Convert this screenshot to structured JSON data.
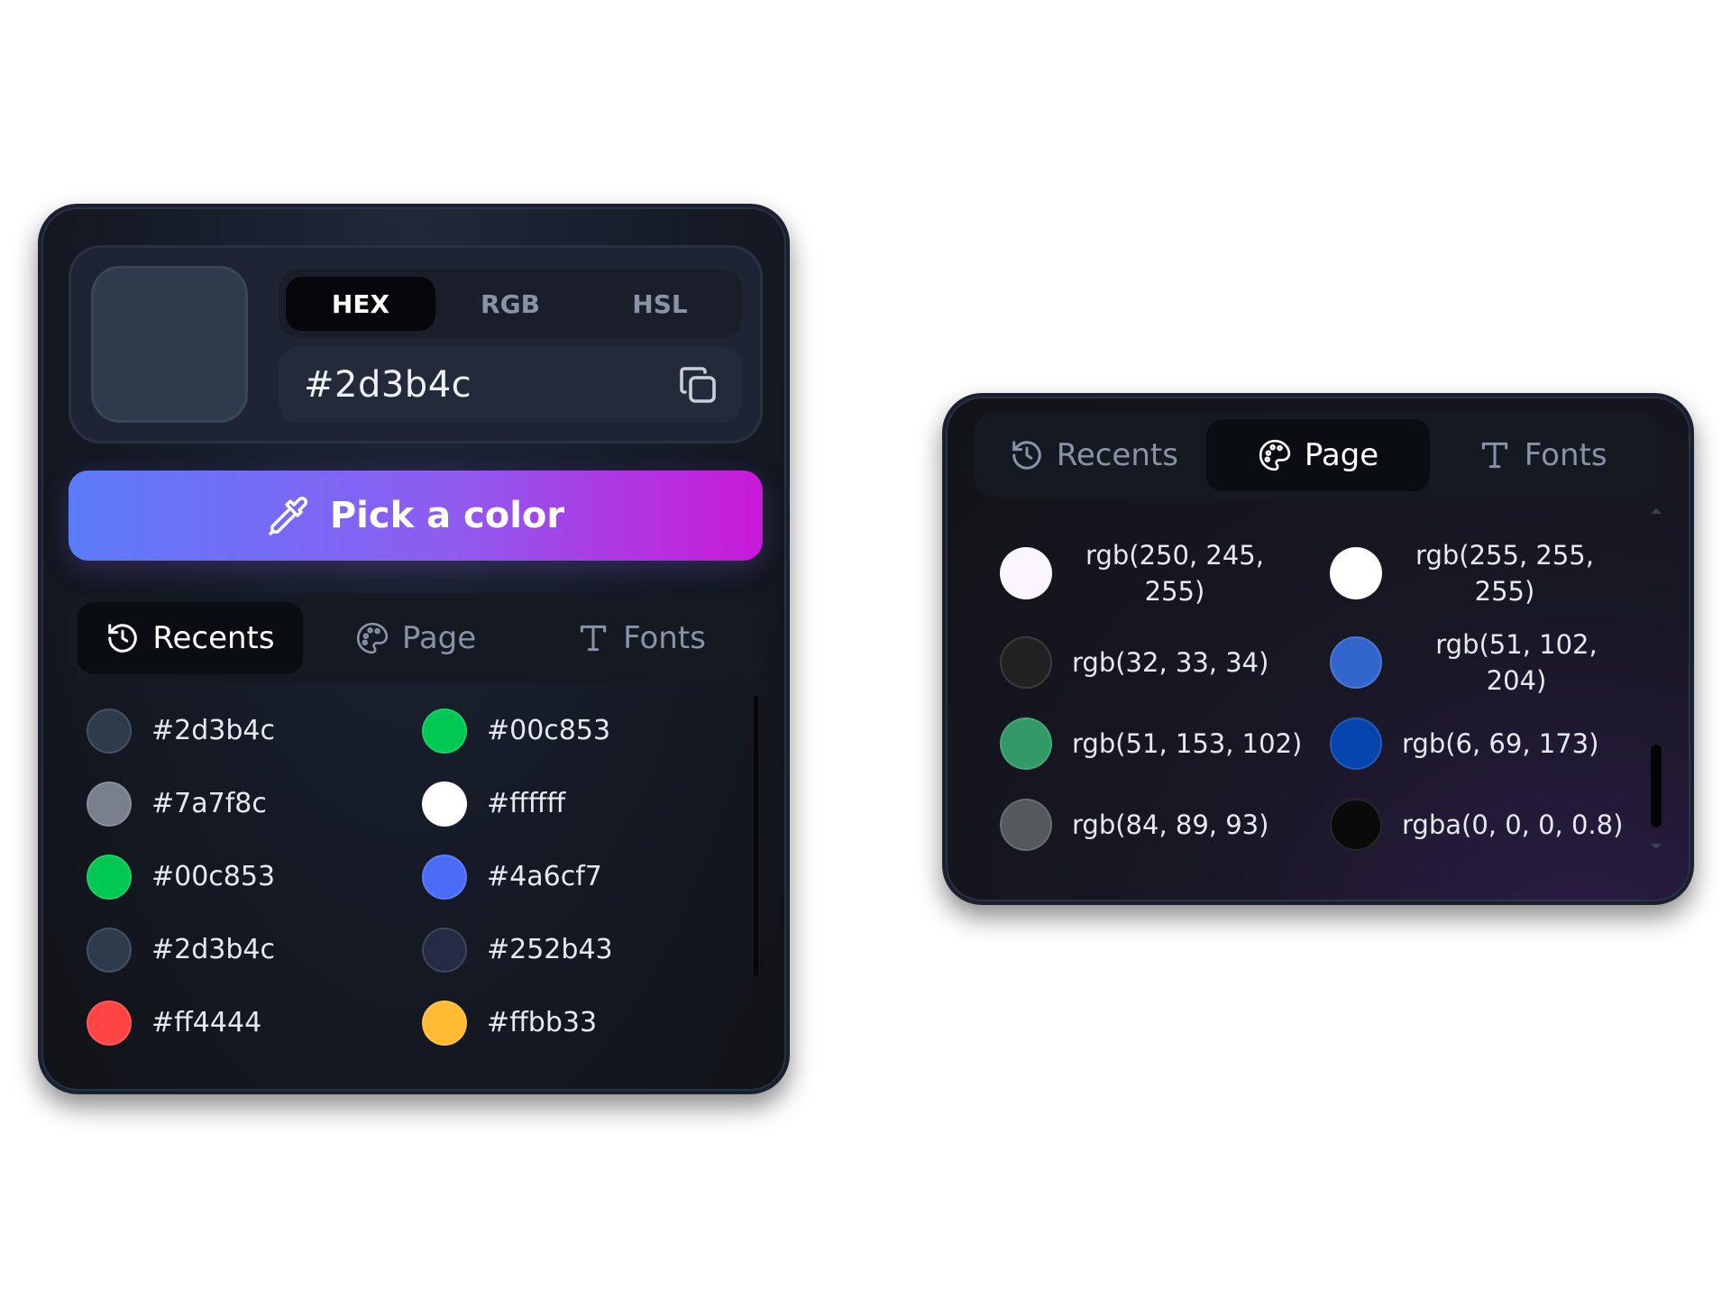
{
  "main_panel": {
    "current_color": "#2d3b4c",
    "format_tabs": [
      {
        "label": "HEX",
        "active": true
      },
      {
        "label": "RGB",
        "active": false
      },
      {
        "label": "HSL",
        "active": false
      }
    ],
    "hex_value": "#2d3b4c",
    "copy_icon": "copy-icon",
    "pick_button": {
      "label": "Pick a color",
      "icon": "eyedropper-icon"
    },
    "section_tabs": [
      {
        "label": "Recents",
        "icon": "history-icon",
        "active": true
      },
      {
        "label": "Page",
        "icon": "palette-icon",
        "active": false
      },
      {
        "label": "Fonts",
        "icon": "type-icon",
        "active": false
      }
    ],
    "recent_colors": [
      {
        "label": "#2d3b4c",
        "color": "#2d3b4c"
      },
      {
        "label": "#00c853",
        "color": "#00c853"
      },
      {
        "label": "#7a7f8c",
        "color": "#7a7f8c"
      },
      {
        "label": "#ffffff",
        "color": "#ffffff"
      },
      {
        "label": "#00c853",
        "color": "#00c853"
      },
      {
        "label": "#4a6cf7",
        "color": "#4a6cf7"
      },
      {
        "label": "#2d3b4c",
        "color": "#2d3b4c"
      },
      {
        "label": "#252b43",
        "color": "#252b43"
      },
      {
        "label": "#ff4444",
        "color": "#ff4444"
      },
      {
        "label": "#ffbb33",
        "color": "#ffbb33"
      }
    ]
  },
  "page_panel": {
    "section_tabs": [
      {
        "label": "Recents",
        "icon": "history-icon",
        "active": false
      },
      {
        "label": "Page",
        "icon": "palette-icon",
        "active": true
      },
      {
        "label": "Fonts",
        "icon": "type-icon",
        "active": false
      }
    ],
    "page_colors": [
      {
        "label": "rgb(250, 245, 255)",
        "color": "#faf5ff"
      },
      {
        "label": "rgb(255, 255, 255)",
        "color": "#ffffff"
      },
      {
        "label": "rgb(32, 33, 34)",
        "color": "#202122"
      },
      {
        "label": "rgb(51, 102, 204)",
        "color": "#3366cc"
      },
      {
        "label": "rgb(51, 153, 102)",
        "color": "#339966"
      },
      {
        "label": "rgb(6, 69, 173)",
        "color": "#0645ad"
      },
      {
        "label": "rgb(84, 89, 93)",
        "color": "#54595d"
      },
      {
        "label": "rgba(0, 0, 0, 0.8)",
        "color": "#0a0a0a"
      }
    ]
  }
}
